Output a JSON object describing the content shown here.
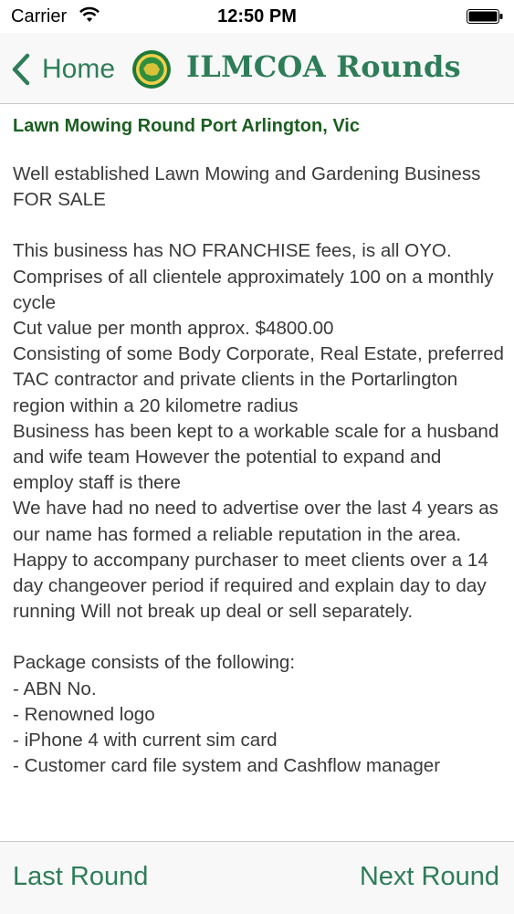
{
  "status_bar": {
    "carrier": "Carrier",
    "time": "12:50 PM"
  },
  "nav": {
    "back_label": "Home",
    "title": "ILMCOA Rounds"
  },
  "listing": {
    "title": "Lawn Mowing Round Port Arlington, Vic",
    "intro": "Well established Lawn Mowing and Gardening Business FOR SALE",
    "details": [
      "This business has NO FRANCHISE fees, is all OYO.",
      "Comprises of all clientele approximately 100 on a monthly cycle",
      "Cut value per month approx. $4800.00",
      "Consisting of some Body Corporate, Real Estate, preferred TAC contractor and private clients in the Portarlington region within a 20 kilometre radius",
      "Business has been kept to a workable scale for a husband and wife team However the potential to expand and employ staff is there",
      "We have had no need to advertise over the last 4 years as our name has formed a reliable reputation in the area.",
      "Happy to accompany purchaser to meet clients over a 14 day changeover period if required and explain day to day running Will not break up deal or sell separately."
    ],
    "package_heading": "Package consists of the following:",
    "package_items": [
      "- ABN No.",
      "- Renowned logo",
      "- iPhone 4 with current sim card",
      "- Customer card file system and Cashflow manager"
    ]
  },
  "toolbar": {
    "prev_label": "Last Round",
    "next_label": "Next Round"
  },
  "colors": {
    "accent": "#2e7d59",
    "heading": "#1b5e20",
    "text": "#3a3a3a"
  }
}
